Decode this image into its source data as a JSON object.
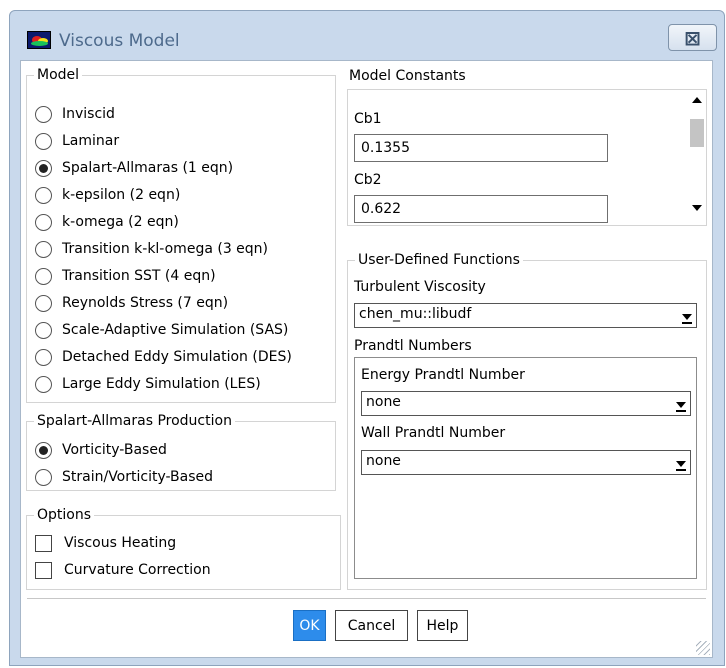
{
  "window": {
    "title": "Viscous Model",
    "close_glyph": "⊠"
  },
  "model": {
    "title": "Model",
    "options": [
      {
        "label": "Inviscid",
        "selected": false
      },
      {
        "label": "Laminar",
        "selected": false
      },
      {
        "label": "Spalart-Allmaras (1 eqn)",
        "selected": true
      },
      {
        "label": "k-epsilon (2 eqn)",
        "selected": false
      },
      {
        "label": "k-omega (2 eqn)",
        "selected": false
      },
      {
        "label": "Transition k-kl-omega (3 eqn)",
        "selected": false
      },
      {
        "label": "Transition SST (4 eqn)",
        "selected": false
      },
      {
        "label": "Reynolds Stress (7 eqn)",
        "selected": false
      },
      {
        "label": "Scale-Adaptive Simulation (SAS)",
        "selected": false
      },
      {
        "label": "Detached Eddy Simulation (DES)",
        "selected": false
      },
      {
        "label": "Large Eddy Simulation (LES)",
        "selected": false
      }
    ]
  },
  "production": {
    "title": "Spalart-Allmaras Production",
    "options": [
      {
        "label": "Vorticity-Based",
        "selected": true
      },
      {
        "label": "Strain/Vorticity-Based",
        "selected": false
      }
    ]
  },
  "options": {
    "title": "Options",
    "items": [
      {
        "label": "Viscous Heating",
        "checked": false
      },
      {
        "label": "Curvature Correction",
        "checked": false
      }
    ]
  },
  "constants": {
    "title": "Model Constants",
    "items": [
      {
        "label": "Cb1",
        "value": "0.1355"
      },
      {
        "label": "Cb2",
        "value": "0.622"
      }
    ]
  },
  "udf": {
    "title": "User-Defined Functions",
    "turbulent_viscosity_label": "Turbulent Viscosity",
    "turbulent_viscosity_value": "chen_mu::libudf",
    "prandtl_title": "Prandtl Numbers",
    "energy_label": "Energy Prandtl Number",
    "energy_value": "none",
    "wall_label": "Wall Prandtl Number",
    "wall_value": "none"
  },
  "buttons": {
    "ok": "OK",
    "cancel": "Cancel",
    "help": "Help"
  },
  "colors": {
    "primary_button": "#2d8ceb",
    "window_frame": "#c9d9ec"
  }
}
